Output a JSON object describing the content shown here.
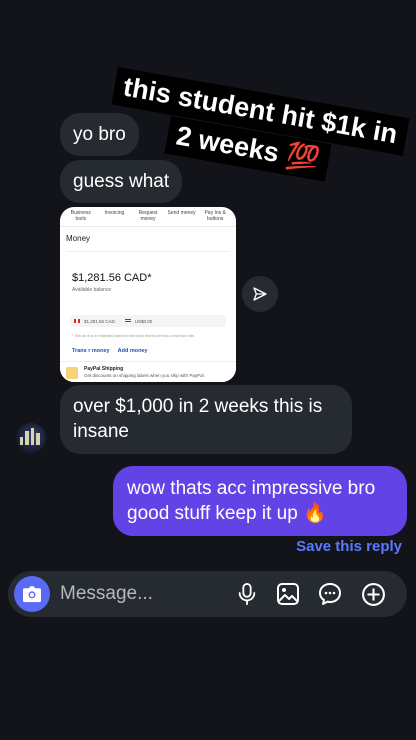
{
  "overlay": {
    "line1": "this student hit $1k in",
    "line2": "2 weeks 💯"
  },
  "messages": [
    {
      "text": "yo bro"
    },
    {
      "text": "guess what"
    },
    {
      "text": "over $1,000 in 2 weeks this is insane"
    }
  ],
  "shared_screenshot": {
    "nav": [
      "Business tools",
      "Invoicing",
      "Request money",
      "Send money",
      "Pay Ins & buttons"
    ],
    "title": "Money",
    "balance": "$1,281.56 CAD*",
    "balance_label": "Available balance",
    "currency_row_1": "$1,281.56 CAD",
    "currency_row_2": "US$0.00",
    "footnote": "* This an    nt is an estimated based on the most recent currency conversion rate.",
    "links": [
      "Trans   r money",
      "Add money"
    ],
    "promo_title": "PayPal Shipping",
    "promo_text": "Get discounts on shipping labels when you ship with PayPal."
  },
  "outgoing": {
    "text": "wow thats acc impressive bro good stuff keep it up 🔥"
  },
  "save_reply": "Save this reply",
  "composer": {
    "placeholder": "Message..."
  },
  "icons": {
    "share": "send-arrow-icon",
    "camera": "camera-icon",
    "mic": "microphone-icon",
    "gallery": "gallery-icon",
    "sticker": "chat-sticker-icon",
    "add": "plus-circle-icon"
  },
  "colors": {
    "background": "#121419",
    "incoming_bubble": "#262a31",
    "outgoing_bubble": "#6243e6",
    "accent_link": "#5a78ff",
    "camera_button": "#5a6af5"
  }
}
